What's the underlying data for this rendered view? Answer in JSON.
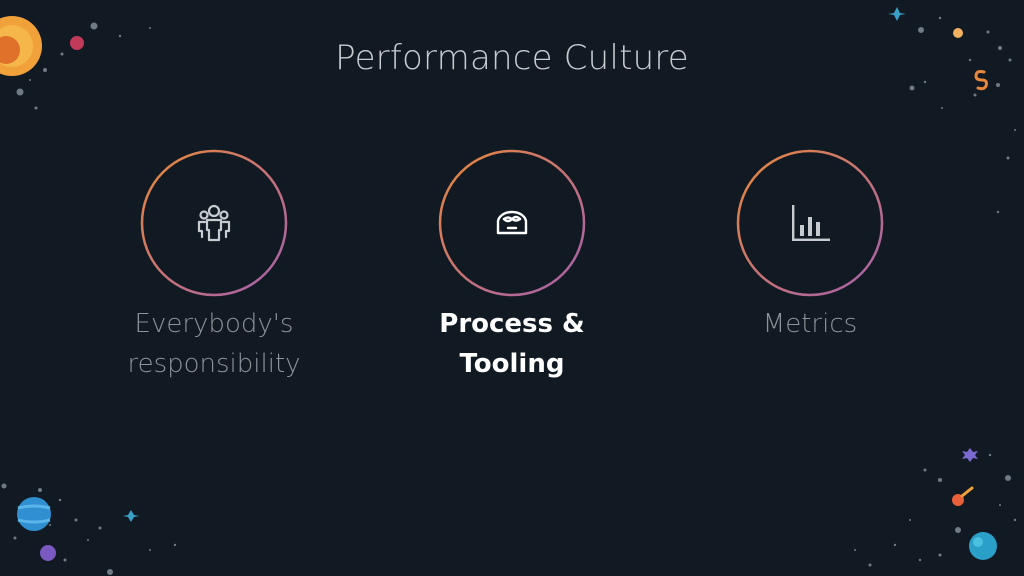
{
  "slide": {
    "title": "Performance Culture",
    "items": [
      {
        "label_line1": "Everybody's",
        "label_line2": "responsibility",
        "icon": "people-icon",
        "active": false
      },
      {
        "label_line1": "Process &",
        "label_line2": "Tooling",
        "icon": "robot-icon",
        "active": true
      },
      {
        "label_line1": "Metrics",
        "label_line2": "",
        "icon": "bar-chart-icon",
        "active": false
      }
    ]
  },
  "colors": {
    "background": "#111a22",
    "ring_start": "#e8883a",
    "ring_end": "#a45fb0",
    "icon": "#c7ccd1",
    "label_muted": "#8c939b",
    "label_active": "#ffffff"
  }
}
